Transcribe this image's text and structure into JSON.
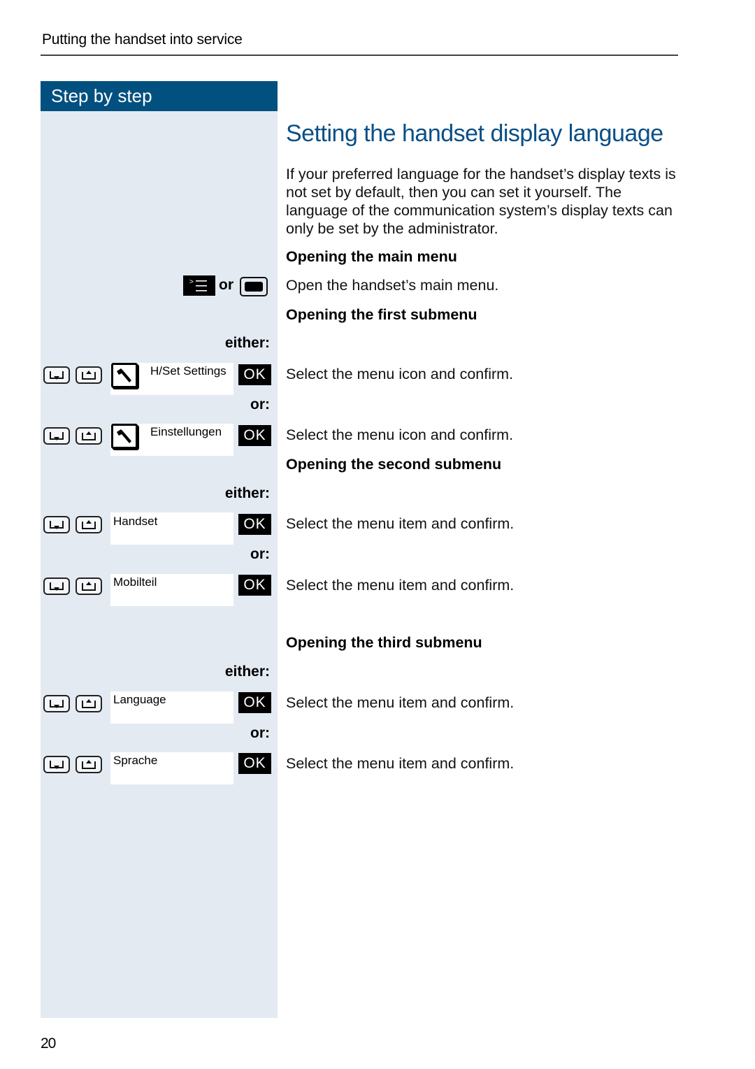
{
  "running_head": "Putting the handset into service",
  "sidebar": {
    "header": "Step by step"
  },
  "title": "Setting the handset display language",
  "intro": "If your preferred language for the handset’s display texts is not set by default, then you can set it yourself. The language of the communication system’s display texts can only be set by the administrator.",
  "colors": {
    "accent": "#02507f",
    "title": "#0a4f86",
    "sidebar_bg": "#e3eaf2"
  },
  "sections": {
    "main_menu": {
      "heading": "Opening the main menu",
      "keys_or": "or",
      "key_icons": [
        "menu-key-icon",
        "display-key-icon"
      ],
      "text": "Open the handset’s main menu."
    },
    "first_submenu": {
      "heading": "Opening the first submenu",
      "either": "either:",
      "or": "or:",
      "options": [
        {
          "display": "H/Set Settings",
          "icon": "wrench-icon",
          "ok": "OK",
          "text": "Select the menu icon and confirm."
        },
        {
          "display": "Einstellungen",
          "icon": "wrench-icon",
          "ok": "OK",
          "text": "Select the menu icon and confirm."
        }
      ]
    },
    "second_submenu": {
      "heading": "Opening the second submenu",
      "either": "either:",
      "or": "or:",
      "options": [
        {
          "display": "Handset",
          "ok": "OK",
          "text": "Select the menu item and confirm."
        },
        {
          "display": "Mobilteil",
          "ok": "OK",
          "text": "Select the menu item and confirm."
        }
      ]
    },
    "third_submenu": {
      "heading": "Opening the third submenu",
      "either": "either:",
      "or": "or:",
      "options": [
        {
          "display": "Language",
          "ok": "OK",
          "text": "Select the menu item and confirm."
        },
        {
          "display": "Sprache",
          "ok": "OK",
          "text": "Select the menu item and confirm."
        }
      ]
    }
  },
  "page_number": "20"
}
